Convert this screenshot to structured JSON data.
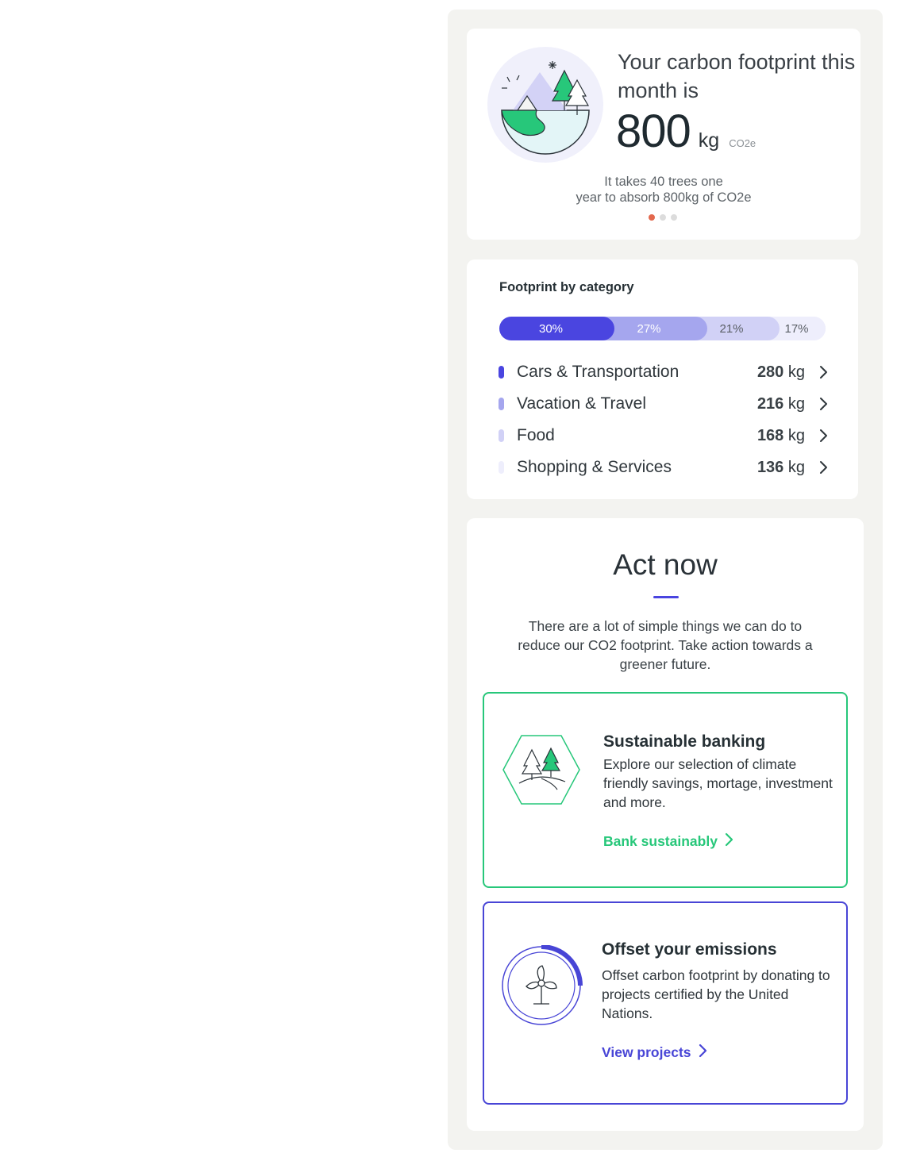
{
  "footprint": {
    "headline": "Your carbon footprint this month is",
    "value": "800",
    "unit": "kg",
    "unit_sub": "CO2e",
    "note_line1": "It takes 40 trees one",
    "note_line2": "year to absorb 800kg of CO2e",
    "carousel_active_index": 0,
    "carousel_count": 3
  },
  "categories": {
    "title": "Footprint by category",
    "bar": [
      {
        "pct": "30%",
        "share": 30,
        "color": "#4a45e0",
        "text_color": "#ffffff"
      },
      {
        "pct": "27%",
        "share": 27,
        "color": "#a5a6ee",
        "text_color": "#ffffff"
      },
      {
        "pct": "21%",
        "share": 21,
        "color": "#d1d1f6",
        "text_color": "#5a5f66"
      },
      {
        "pct": "17%",
        "share": 17,
        "color": "#eeeefc",
        "text_color": "#5a5f66"
      }
    ],
    "items": [
      {
        "label": "Cars & Transportation",
        "value": "280",
        "unit": "kg",
        "color": "#4a45e0"
      },
      {
        "label": "Vacation & Travel",
        "value": "216",
        "unit": "kg",
        "color": "#a5a6ee"
      },
      {
        "label": "Food",
        "value": "168",
        "unit": "kg",
        "color": "#d1d1f6"
      },
      {
        "label": "Shopping & Services",
        "value": "136",
        "unit": "kg",
        "color": "#eeeefc"
      }
    ]
  },
  "act": {
    "title": "Act now",
    "text": "There are a lot of simple things we can do to reduce our CO2 footprint. Take action towards a greener future.",
    "tiles": [
      {
        "title": "Sustainable banking",
        "desc": "Explore our selection of climate friendly savings, mortage, investment and more.",
        "link": "Bank sustainably",
        "accent": "#27c77a",
        "icon": "trees-hexagon-icon"
      },
      {
        "title": "Offset your emissions",
        "desc": "Offset carbon footprint by donating to projects certified by the United Nations.",
        "link": "View projects",
        "accent": "#4845d6",
        "icon": "wind-turbine-icon"
      }
    ]
  },
  "colors": {
    "primary": "#4a45e0",
    "green": "#27c77a",
    "panel_bg": "#f3f3f0",
    "dot_active": "#e3684d"
  }
}
